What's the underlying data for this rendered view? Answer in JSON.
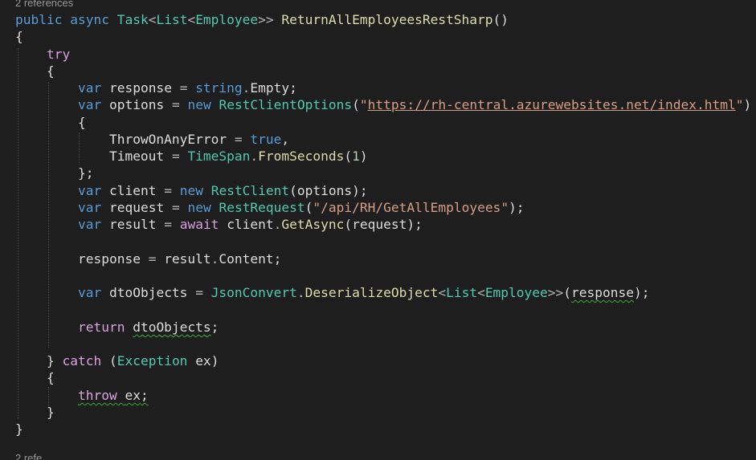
{
  "codelens": {
    "top": "2 references",
    "bottom": "2 refe"
  },
  "code": {
    "signature": {
      "mod1": "public",
      "mod2": "async",
      "task": "Task",
      "list": "List",
      "employee": "Employee",
      "method": "ReturnAllEmployeesRestSharp"
    },
    "kw_try": "try",
    "kw_var": "var",
    "kw_new": "new",
    "kw_await": "await",
    "kw_return": "return",
    "kw_catch": "catch",
    "kw_throw": "throw",
    "kw_string": "string",
    "kw_true": "true",
    "ident_response": "response",
    "ident_options": "options",
    "ident_client": "client",
    "ident_request": "request",
    "ident_result": "result",
    "ident_dtoObjects": "dtoObjects",
    "ident_ex": "ex",
    "member_Empty": "Empty",
    "member_Content": "Content",
    "prop_ThrowOnAnyError": "ThrowOnAnyError",
    "prop_Timeout": "Timeout",
    "type_RestClientOptions": "RestClientOptions",
    "type_RestClient": "RestClient",
    "type_RestRequest": "RestRequest",
    "type_TimeSpan": "TimeSpan",
    "type_JsonConvert": "JsonConvert",
    "type_Exception": "Exception",
    "method_FromSeconds": "FromSeconds",
    "method_GetAsync": "GetAsync",
    "method_DeserializeObject": "DeserializeObject",
    "str_url": "https://rh-central.azurewebsites.net/index.html",
    "str_path": "/api/RH/GetAllEmployees",
    "num_timeout": "1"
  },
  "colors": {
    "background": "#1e1e1e",
    "keyword": "#569cd6",
    "control": "#d8a0df",
    "type": "#4ec9b0",
    "method": "#dcdcaa",
    "string": "#d69d85",
    "number": "#b5cea8",
    "squiggle": "#39a83a"
  }
}
